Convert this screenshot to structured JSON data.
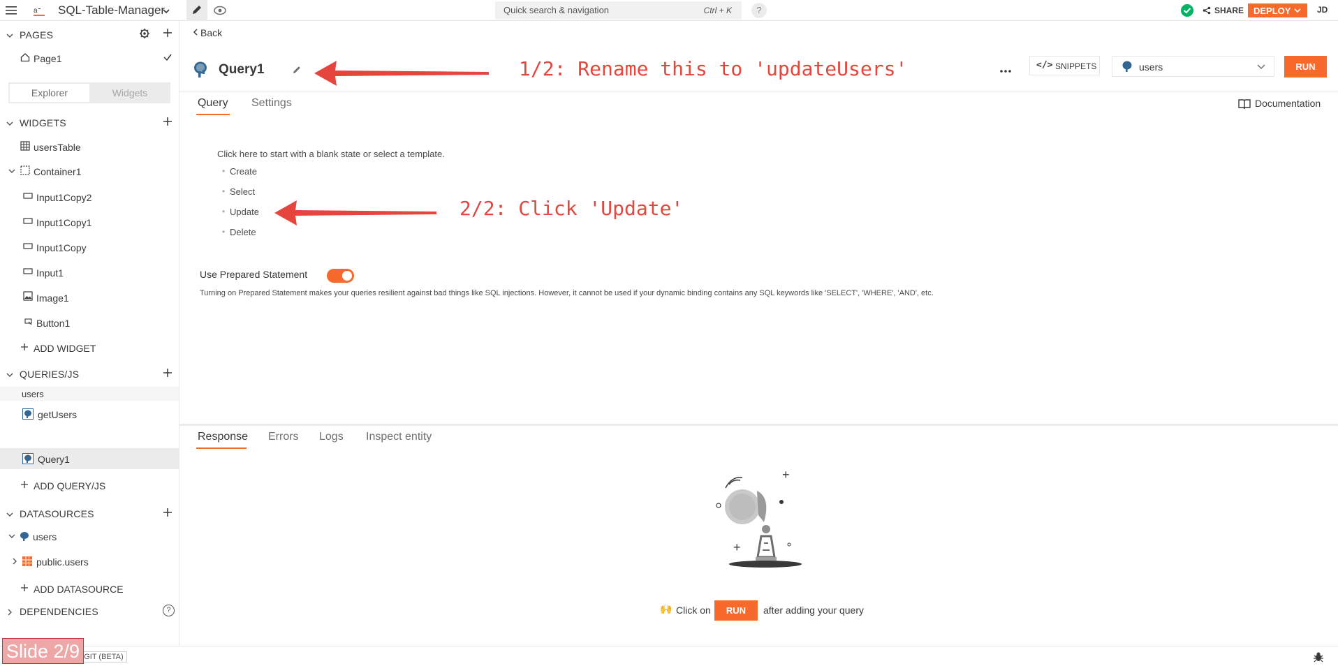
{
  "topbar": {
    "app_name": "SQL-Table-Manager",
    "search_placeholder": "Quick search & navigation",
    "search_shortcut": "Ctrl + K",
    "help": "?",
    "share_label": "SHARE",
    "deploy_label": "DEPLOY",
    "avatar_initials": "JD"
  },
  "sidebar": {
    "pages_title": "PAGES",
    "page_name": "Page1",
    "toggle_explorer": "Explorer",
    "toggle_widgets": "Widgets",
    "widgets_title": "WIDGETS",
    "widgets": [
      "usersTable",
      "Container1",
      "Input1Copy2",
      "Input1Copy1",
      "Input1Copy",
      "Input1",
      "Image1",
      "Button1"
    ],
    "add_widget": "ADD WIDGET",
    "queries_title": "QUERIES/JS",
    "queries_group": "users",
    "queries": [
      "getUsers",
      "Query1"
    ],
    "add_query": "ADD QUERY/JS",
    "datasources_title": "DATASOURCES",
    "datasource_name": "users",
    "datasource_table": "public.users",
    "add_datasource": "ADD DATASOURCE",
    "dependencies_title": "DEPENDENCIES"
  },
  "editor": {
    "back_label": "Back",
    "query_name": "Query1",
    "snippets_label": "SNIPPETS",
    "datasource_selected": "users",
    "run_label": "RUN",
    "tabs": [
      "Query",
      "Settings"
    ],
    "documentation_label": "Documentation",
    "template_intro": "Click here to start with a blank state or select a template.",
    "templates": [
      "Create",
      "Select",
      "Update",
      "Delete"
    ],
    "prepared_label": "Use Prepared Statement",
    "prepared_enabled": true,
    "prepared_help": "Turning on Prepared Statement makes your queries resilient against bad things like SQL injections. However, it cannot be used if your dynamic binding contains any SQL keywords like 'SELECT', 'WHERE', 'AND', etc."
  },
  "response": {
    "tabs": [
      "Response",
      "Errors",
      "Logs",
      "Inspect entity"
    ],
    "hint_prefix": "Click on",
    "hint_button": "RUN",
    "hint_suffix": "after adding your query"
  },
  "annotations": {
    "step1": "1/2: Rename this to 'updateUsers'",
    "step2": "2/2: Click 'Update'"
  },
  "footer": {
    "git_label": "CONNECT GIT (BETA)",
    "slide_label": "Slide 2/9"
  },
  "colors": {
    "accent": "#f86a2b",
    "annotation": "#e5453c",
    "success": "#03b365"
  }
}
